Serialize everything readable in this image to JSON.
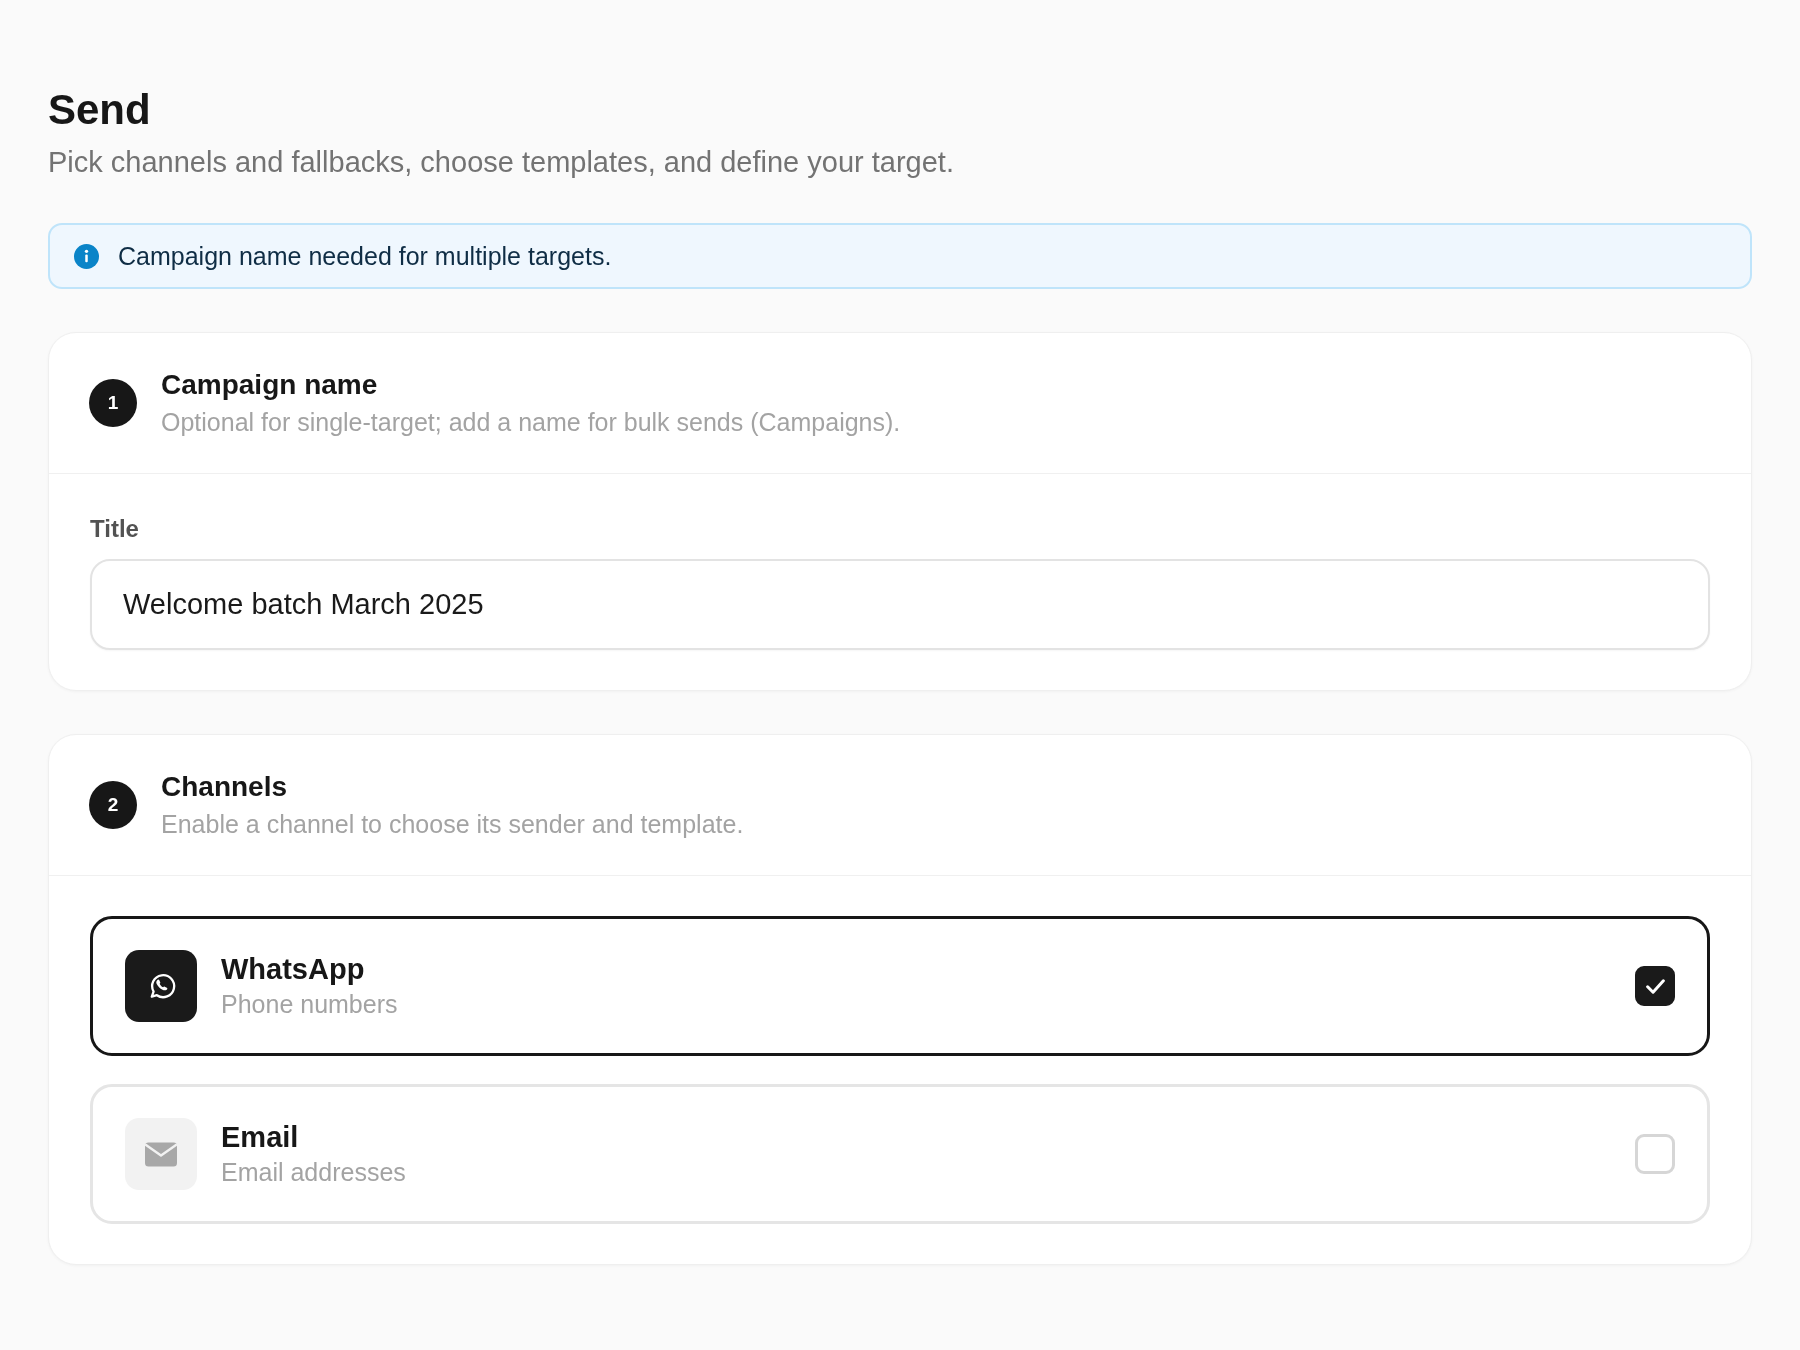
{
  "page": {
    "title": "Send",
    "subtitle": "Pick channels and fallbacks, choose templates, and define your target."
  },
  "notice": {
    "text": "Campaign name needed for multiple targets."
  },
  "sections": [
    {
      "kind": "form",
      "step": "1",
      "title": "Campaign name",
      "description": "Optional for single-target; add a name for bulk sends (Campaigns).",
      "fields": [
        {
          "label": "Title",
          "value": "Welcome batch March 2025"
        }
      ]
    },
    {
      "kind": "channels",
      "step": "2",
      "title": "Channels",
      "description": "Enable a channel to choose its sender and template.",
      "channels": [
        {
          "kind": "whatsapp",
          "name": "WhatsApp",
          "description": "Phone numbers",
          "checked": true
        },
        {
          "kind": "email",
          "name": "Email",
          "description": "Email addresses",
          "checked": false
        }
      ]
    }
  ]
}
